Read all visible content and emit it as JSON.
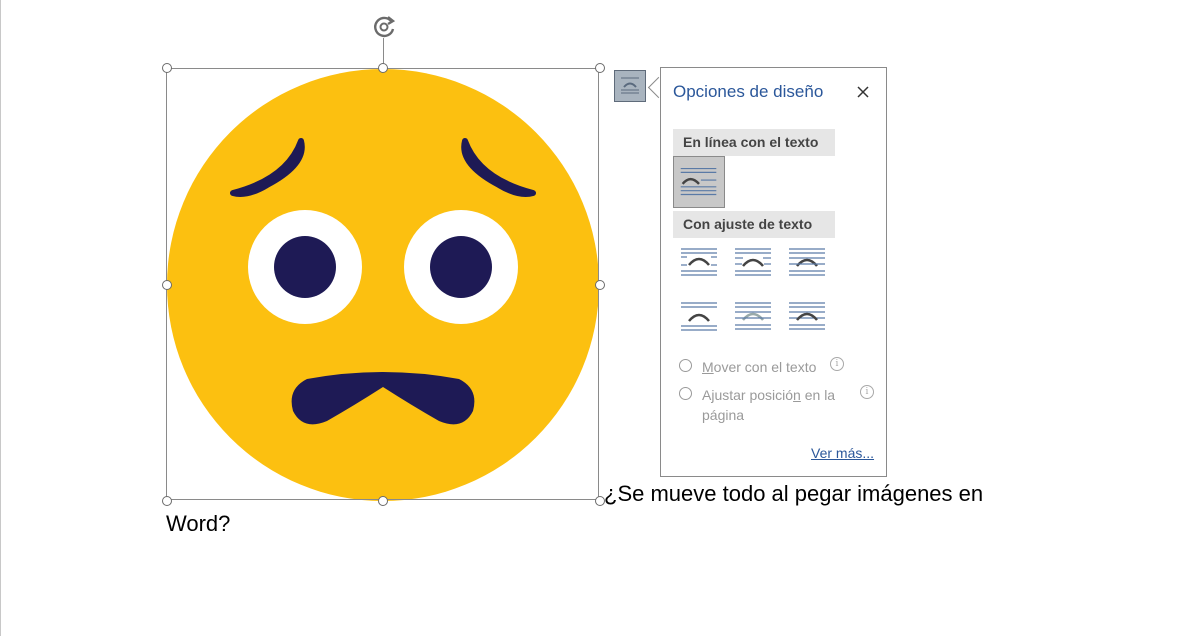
{
  "layout_options": {
    "title": "Opciones de diseño",
    "close_label": "×",
    "section_inline": "En línea con el texto",
    "section_wrapping": "Con ajuste de texto",
    "move_with_text_prefix": "M",
    "move_with_text_rest": "over con el texto",
    "fix_position_prefix": "Ajustar posició",
    "fix_position_underline": "n",
    "fix_position_rest": " en la",
    "fix_position_line2": "página",
    "see_more": "Ver más...",
    "info_glyph": "i",
    "accent_color": "#2b579a"
  },
  "document": {
    "line1": "¿Se mueve todo al pegar imágenes en",
    "line2": "Word?"
  },
  "image": {
    "description_icon": "worried-face-emoji",
    "face_color": "#fcc010",
    "feature_color": "#1e1a55"
  }
}
